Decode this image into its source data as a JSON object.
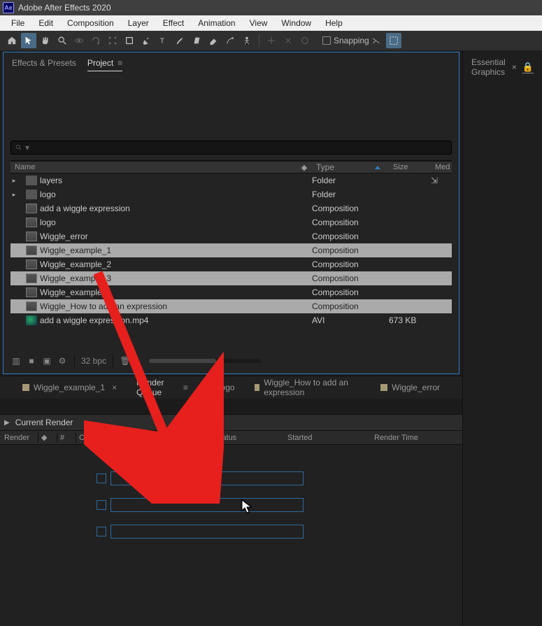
{
  "titlebar": {
    "badge": "Ae",
    "title": "Adobe After Effects 2020"
  },
  "menubar": [
    "File",
    "Edit",
    "Composition",
    "Layer",
    "Effect",
    "Animation",
    "View",
    "Window",
    "Help"
  ],
  "toolbar": {
    "snapping_label": "Snapping"
  },
  "panels": {
    "left_tab_inactive": "Effects & Presets",
    "left_tab_active": "Project",
    "right_tab": "Essential Graphics",
    "right_close": "×",
    "right_lock": "🔒"
  },
  "search": {
    "placeholder": ""
  },
  "project_columns": {
    "name": "Name",
    "tag": "◆",
    "type": "Type",
    "size": "Size",
    "media": "Med"
  },
  "project_rows": [
    {
      "kind": "folder",
      "name": "layers",
      "type": "Folder",
      "swatch": "yellow",
      "disc": true,
      "med": "⇲"
    },
    {
      "kind": "folder",
      "name": "logo",
      "type": "Folder",
      "swatch": "yellow",
      "disc": true
    },
    {
      "kind": "comp",
      "name": "add a wiggle expression",
      "type": "Composition",
      "swatch": "tan"
    },
    {
      "kind": "comp",
      "name": "logo",
      "type": "Composition",
      "swatch": "tan"
    },
    {
      "kind": "comp",
      "name": "Wiggle_error",
      "type": "Composition",
      "swatch": "tan"
    },
    {
      "kind": "comp",
      "name": "Wiggle_example_1",
      "type": "Composition",
      "swatch": "tan",
      "selected": true
    },
    {
      "kind": "comp",
      "name": "Wiggle_example_2",
      "type": "Composition",
      "swatch": "tan"
    },
    {
      "kind": "comp",
      "name": "Wiggle_example_3",
      "type": "Composition",
      "swatch": "tan",
      "selected": true
    },
    {
      "kind": "comp",
      "name": "Wiggle_example_4",
      "type": "Composition",
      "swatch": "tan"
    },
    {
      "kind": "comp",
      "name": "Wiggle_How to add an expression",
      "type": "Composition",
      "swatch": "tan",
      "selected": true
    },
    {
      "kind": "file",
      "name": "add a wiggle expression.mp4",
      "type": "AVI",
      "size": "673 KB",
      "swatch": "cyan"
    }
  ],
  "project_footer": {
    "bpc": "32 bpc"
  },
  "comp_tabs": [
    {
      "label": "Wiggle_example_1",
      "close": true
    },
    {
      "label": "Render Queue",
      "active": true,
      "menu": true,
      "noicon": true
    },
    {
      "label": "logo"
    },
    {
      "label": "Wiggle_How to add an expression"
    },
    {
      "label": "Wiggle_error"
    }
  ],
  "render_section": {
    "current": "Current Render",
    "columns": {
      "render": "Render",
      "tag": "◆",
      "num": "#",
      "comp": "Comp Name",
      "status": "Status",
      "started": "Started",
      "rtime": "Render Time"
    }
  }
}
